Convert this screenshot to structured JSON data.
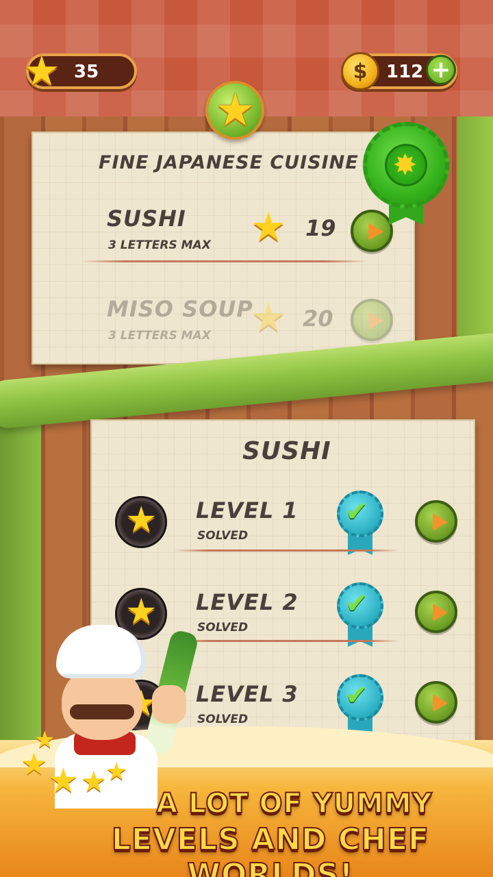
{
  "top_bar": {
    "stars_count": "35",
    "coins_count": "112",
    "coin_symbol": "$",
    "add_symbol": "+"
  },
  "world_card": {
    "title": "FINE JAPANESE CUISINE",
    "items": [
      {
        "name": "SUSHI",
        "subtitle": "3 LETTERS MAX",
        "stars": "19",
        "locked": false
      },
      {
        "name": "MISO SOUP",
        "subtitle": "3 LETTERS MAX",
        "stars": "20",
        "locked": true
      }
    ]
  },
  "level_card": {
    "title": "SUSHI",
    "levels": [
      {
        "name": "LEVEL 1",
        "status": "SOLVED"
      },
      {
        "name": "LEVEL 2",
        "status": "SOLVED"
      },
      {
        "name": "LEVEL 3",
        "status": "SOLVED"
      }
    ]
  },
  "slogan": {
    "line1": "A LOT OF YUMMY",
    "line2": "LEVELS AND CHEF WORLDS!"
  },
  "icons": {
    "star": "star-icon",
    "coin": "coin-icon",
    "plus": "plus-icon",
    "play": "play-icon",
    "globe": "globe-icon",
    "medal": "medal-icon",
    "check": "check-ribbon-icon",
    "pan": "frying-pan-icon"
  },
  "colors": {
    "accent_green": "#6c9d23",
    "star_gold": "#ffd21f",
    "text_dark": "#4a3f3a",
    "slogan_yellow": "#ffd84a"
  }
}
